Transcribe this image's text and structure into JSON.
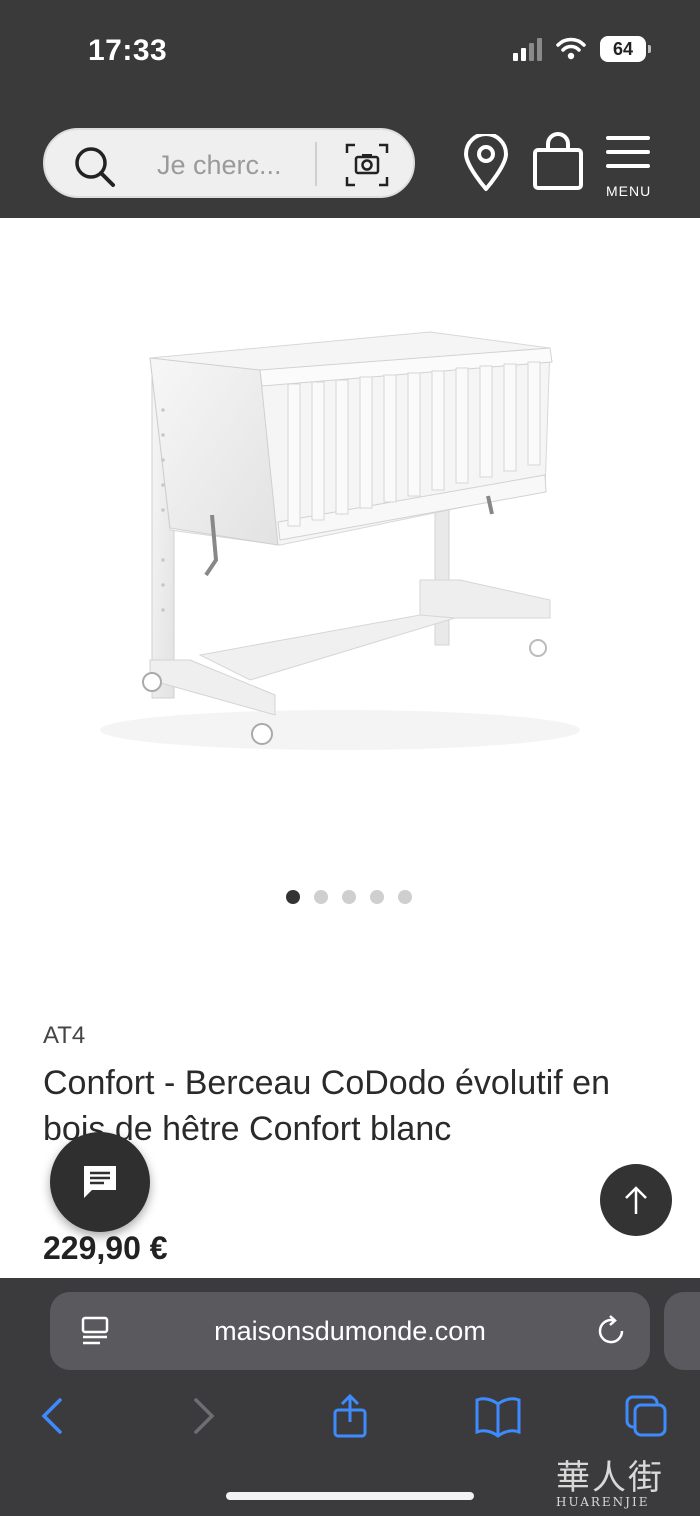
{
  "status": {
    "time": "17:33",
    "battery": "64"
  },
  "header": {
    "search_placeholder": "Je cherc...",
    "menu_label": "MENU"
  },
  "carousel": {
    "total": 5,
    "active_index": 0
  },
  "product": {
    "brand": "AT4",
    "title": "Confort - Berceau CoDodo évolutif en bois de hêtre Confort blanc",
    "price": "229,90 €"
  },
  "browser": {
    "url": "maisonsdumonde.com"
  },
  "watermark": {
    "big": "華人街",
    "small": "HUARENJIE"
  }
}
